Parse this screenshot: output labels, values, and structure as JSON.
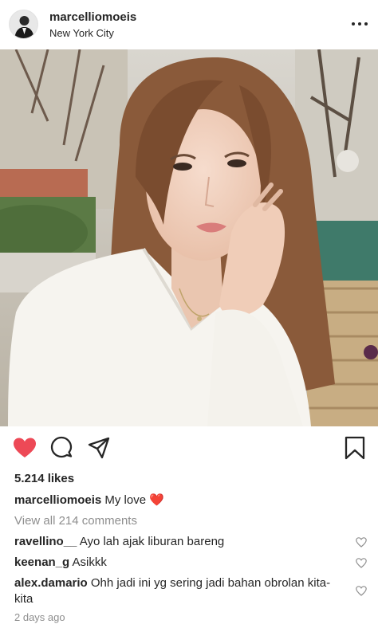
{
  "post": {
    "username": "marcelliomoeis",
    "location": "New York City"
  },
  "stats": {
    "likes": "5.214 likes"
  },
  "caption": {
    "username": "marcelliomoeis",
    "text": "My love",
    "emoji": "❤️"
  },
  "view_all": "View all 214 comments",
  "comments": [
    {
      "username": "ravellino__",
      "text": "Ayo lah ajak liburan bareng"
    },
    {
      "username": "keenan_g",
      "text": "Asikkk"
    },
    {
      "username": "alex.damario",
      "text": "Ohh jadi ini yg sering jadi bahan obrolan kita-kita"
    }
  ],
  "timestamp": "2 days ago",
  "icons": {
    "like": "heart-filled-icon",
    "comment": "comment-bubble-icon",
    "share": "paper-plane-icon",
    "save": "bookmark-icon",
    "more": "more-dots-icon",
    "comment_like": "heart-outline-icon"
  },
  "colors": {
    "like_red": "#ed4956",
    "text": "#262626",
    "muted": "#8e8e8e"
  }
}
